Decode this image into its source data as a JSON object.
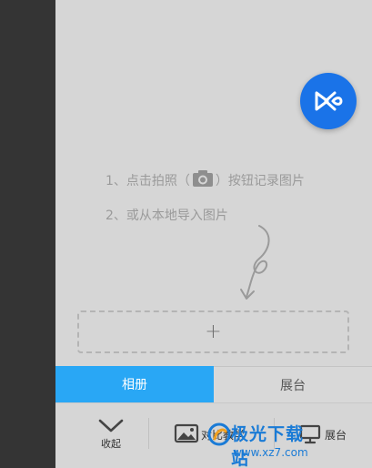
{
  "fab": {
    "icon": "play-logo-icon"
  },
  "instructions": {
    "step1_before": "1、点击拍照（",
    "step1_after": "）按钮记录图片",
    "step2": "2、或从本地导入图片"
  },
  "add_box": {
    "label": "+"
  },
  "tabs": [
    {
      "label": "相册",
      "active": true
    },
    {
      "label": "展台",
      "active": false
    }
  ],
  "toolbar": {
    "collapse_label": "收起",
    "compare_label": "对比教学",
    "exhibit_label": "展台"
  },
  "watermark": {
    "title": "极光下载站",
    "url": "www.xz7.com"
  },
  "colors": {
    "accent": "#29a7f5",
    "fab": "#1a73e8",
    "sidebar": "#343434",
    "background": "#d6d6d6"
  }
}
